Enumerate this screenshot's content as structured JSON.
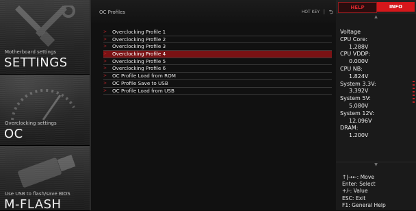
{
  "sidebar": {
    "panels": [
      {
        "subtitle": "Motherboard settings",
        "title": "SETTINGS",
        "icon": "wrench-hammer-icon"
      },
      {
        "subtitle": "Overclocking settings",
        "title": "OC",
        "icon": "speedometer-icon"
      },
      {
        "subtitle": "Use USB to flash/save BIOS",
        "title": "M-FLASH",
        "icon": "usb-flash-icon"
      }
    ]
  },
  "main": {
    "title": "OC Profiles",
    "hotkey_label": "HOT KEY",
    "hotkey_separator": "|",
    "back_icon": "back-arrow-icon",
    "items": [
      "Overclocking Profile 1",
      "Overclocking Profile 2",
      "Overclocking Profile 3",
      "Overclocking Profile 4",
      "Overclocking Profile 5",
      "Overclocking Profile 6",
      "OC Profile Load from ROM",
      "OC Profile Save to USB",
      "OC Profile Load from USB"
    ],
    "selected_index": 3
  },
  "right": {
    "tabs": {
      "help": "HELP",
      "info": "INFO"
    },
    "voltage": {
      "heading": "Voltage",
      "cpu_core_label": "CPU Core:",
      "cpu_core_value": "1.288V",
      "cpu_vddp_label": "CPU VDDP:",
      "cpu_vddp_value": "0.000V",
      "cpu_nb_label": "CPU NB:",
      "cpu_nb_value": "1.824V",
      "sys33_label": "System 3.3V:",
      "sys33_value": "3.392V",
      "sys5_label": "System 5V:",
      "sys5_value": "5.080V",
      "sys12_label": "System 12V:",
      "sys12_value": "12.096V",
      "dram_label": "DRAM:",
      "dram_value": "1.200V"
    },
    "keys": {
      "move": "↑|→←: Move",
      "select": "Enter: Select",
      "value": "+/-: Value",
      "exit": "ESC: Exit",
      "help": "F1: General Help"
    }
  },
  "colors": {
    "accent_red": "#d6171b",
    "selected_row": "#7b1214",
    "arrow_red": "#c0252b"
  }
}
